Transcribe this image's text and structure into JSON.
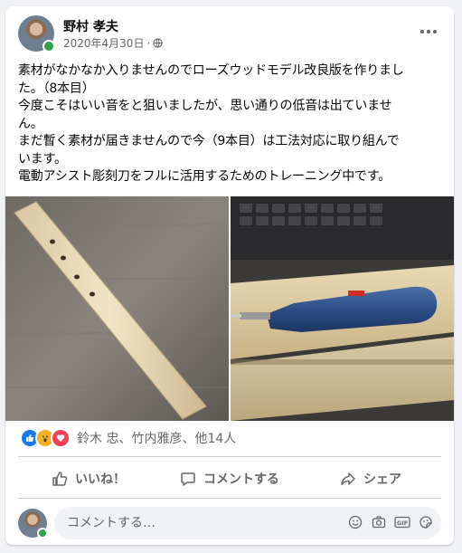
{
  "post": {
    "author": "野村 孝夫",
    "date": "2020年4月30日",
    "separator": "·",
    "lines": [
      "素材がなかなか入りませんのでローズウッドモデル改良版を作りまし",
      "た。（8本目）",
      "今度こそはいい音をと狙いましたが、思い通りの低音は出ていませ",
      "ん。",
      "まだ暫く素材が届きませんので今（9本目）は工法対応に取り組んで",
      "います。",
      "電動アシスト彫刻刀をフルに活用するためのトレーニング中です。"
    ]
  },
  "reactions": {
    "names": "鈴木 忠、竹内雅彦、他14人",
    "icons": [
      "like-icon",
      "wow-icon",
      "love-icon"
    ]
  },
  "actions": {
    "like": "いいね！",
    "comment": "コメントする",
    "share": "シェア"
  },
  "comment_box": {
    "placeholder": "コメントする…"
  },
  "colors": {
    "like": "#1877f2",
    "wow": "#f7b125",
    "love": "#f33e58",
    "online": "#31a24c"
  }
}
